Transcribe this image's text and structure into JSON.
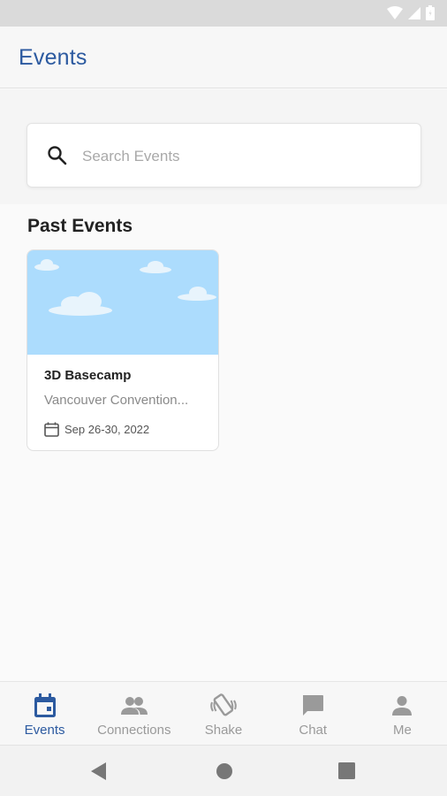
{
  "app_bar": {
    "title": "Events"
  },
  "search": {
    "placeholder": "Search Events",
    "value": ""
  },
  "sections": {
    "past_title": "Past Events"
  },
  "events": [
    {
      "name": "3D Basecamp",
      "location": "Vancouver Convention...",
      "date": "Sep 26-30, 2022"
    }
  ],
  "bottom_nav": {
    "items": [
      {
        "label": "Events",
        "icon": "calendar-icon",
        "active": true
      },
      {
        "label": "Connections",
        "icon": "people-icon"
      },
      {
        "label": "Shake",
        "icon": "shake-phone-icon"
      },
      {
        "label": "Chat",
        "icon": "chat-icon"
      },
      {
        "label": "Me",
        "icon": "person-icon"
      }
    ]
  },
  "colors": {
    "accent": "#2c5aa0",
    "card_sky": "#acdcfd",
    "inactive": "#9a9a9a"
  }
}
